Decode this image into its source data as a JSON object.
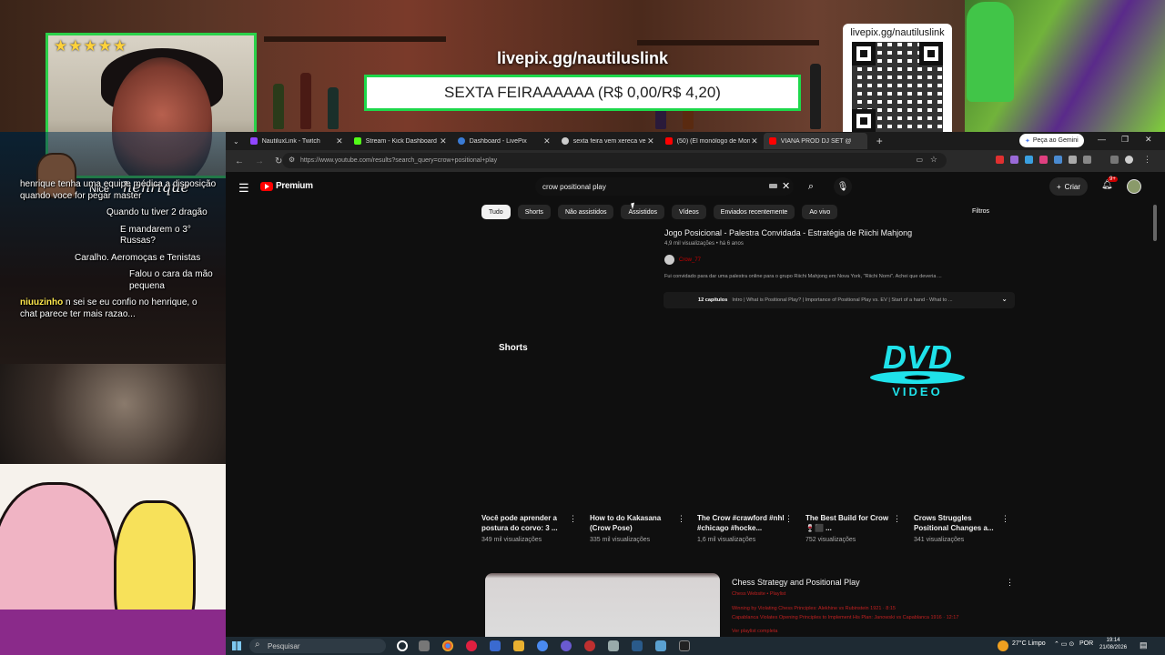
{
  "overlay": {
    "alert_title": "livepix.gg/nautiluslink",
    "alert_text": "SEXTA FEIRAAAAAA (R$ 0,00/R$ 4,20)",
    "qr_label": "livepix.gg/nautiluslink",
    "webcam_stars": "★★★★★",
    "chat_header_prefix": "Nice",
    "chat_header_name": "henrique",
    "chat": [
      {
        "user": "",
        "text": "henrique tenha uma equipe médica a disposição quando voce for pegar master",
        "color": "pink"
      },
      {
        "user": "",
        "text": "Quando tu tiver 2 dragão",
        "color": "pink"
      },
      {
        "user": "",
        "text": "E mandarem o 3° Russas?",
        "color": "pink"
      },
      {
        "user": "",
        "text": "Caralho. Aeromoças e Tenistas",
        "color": "pink"
      },
      {
        "user": "",
        "text": "Falou o cara da mão pequena",
        "color": "pink"
      },
      {
        "user": "niuuzinho",
        "text": "n sei se eu confio no henrique, o chat parece ter mais razao...",
        "color": "yellow"
      }
    ]
  },
  "browser": {
    "tabs": [
      {
        "label": "NautiluxLink - Twitch",
        "color": "#9146ff"
      },
      {
        "label": "Stream - Kick Dashboard",
        "color": "#53fc18"
      },
      {
        "label": "Dashboard - LivePix",
        "color": "#3a7bd5"
      },
      {
        "label": "sexta feira vem xereca vem",
        "color": "#cccccc"
      },
      {
        "label": "(50) (El monólogo de Mon",
        "color": "#ff0000"
      },
      {
        "label": "VIANA PROD DJ SET @",
        "color": "#ff0000"
      }
    ],
    "gemini_label": "Peça ao Gemini",
    "url": "https://www.youtube.com/results?search_query=crow+positional+play"
  },
  "youtube": {
    "logo_text": "Premium",
    "search_value": "crow positional play",
    "create_label": "Criar",
    "notif_count": "9+",
    "chips": [
      "Tudo",
      "Shorts",
      "Não assistidos",
      "Assistidos",
      "Vídeos",
      "Enviados recentemente",
      "Ao vivo"
    ],
    "filters_label": "Filtros",
    "video": {
      "title": "Jogo Posicional - Palestra Convidada - Estratégia de Riichi Mahjong",
      "meta": "4,9 mil visualizações • há 6 anos",
      "channel": "Crow_77",
      "description": "Fui convidado para dar uma palestra online para o grupo Riichi Mahjong em Nova York, \"Riichi Nomi\". Achei que deveria ...",
      "chapters_count": "12 capítulos",
      "chapters_text": "Intro | What is Positional Play? | Importance of Positional Play vs. EV | Start of a hand - What to ..."
    },
    "shorts_heading": "Shorts",
    "dvd_word": "DVD",
    "dvd_sub": "VIDEO",
    "shorts": [
      {
        "title": "Você pode aprender a postura do corvo: 3 ...",
        "views": "349 mil visualizações"
      },
      {
        "title": "How to do Kakasana (Crow Pose)",
        "views": "335 mil visualizações"
      },
      {
        "title": "The Crow #crawford #nhl #chicago #hocke...",
        "views": "1,6 mil visualizações"
      },
      {
        "title": "The Best Build for Crow 🍷⬛ ...",
        "views": "752 visualizações"
      },
      {
        "title": "Crows Struggles Positional Changes a...",
        "views": "341 visualizações"
      }
    ],
    "playlist": {
      "title": "Chess Strategy and Positional Play",
      "channel": "Chess Website • Playlist",
      "line1": "Winning by Violating Chess Principles: Alekhine vs Rubinstein 1921 · 8:15",
      "line2": "Capablanca Violates Opening Principles to Implement His Plan: Janowski vs Capablanca 1916 · 12:17",
      "line3": "Ver playlist completa"
    }
  },
  "taskbar": {
    "search_placeholder": "Pesquisar",
    "weather": "27°C Limpo",
    "lang": "POR",
    "time": "19:14",
    "date": "21/08/2026"
  }
}
